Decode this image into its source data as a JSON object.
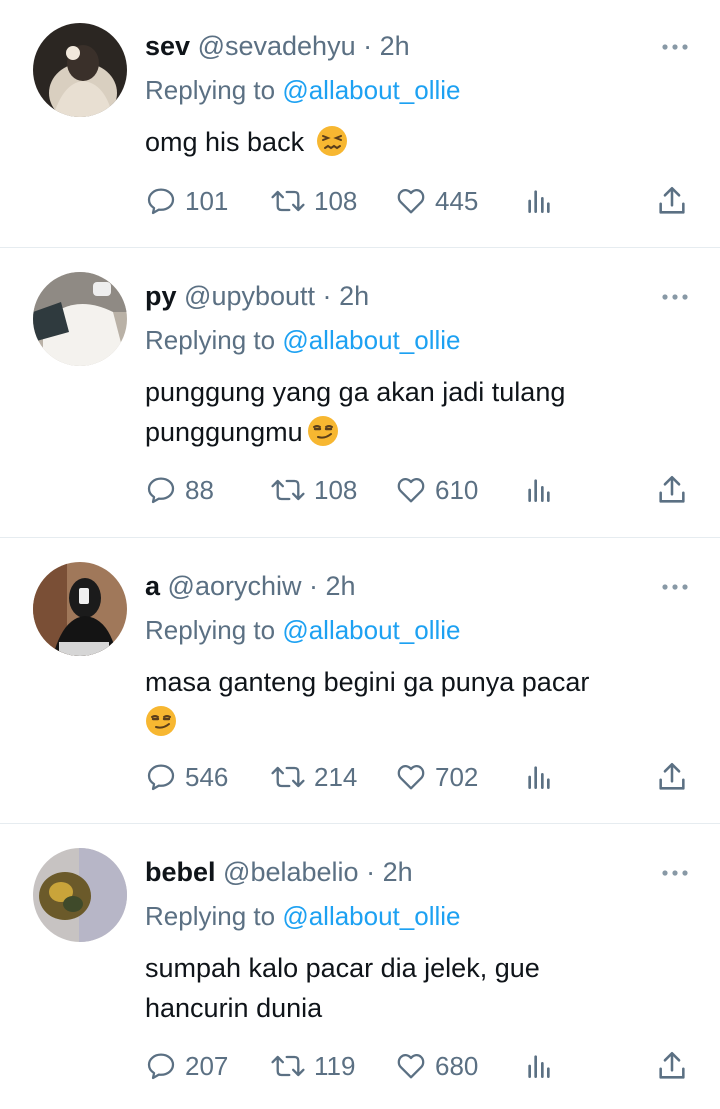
{
  "tweets": [
    {
      "name": "sev",
      "handle": "@sevadehyu",
      "dot": "·",
      "time": "2h",
      "replying_prefix": "Replying to",
      "replying_to": "@allabout_ollie",
      "text_lines": [
        "omg his back"
      ],
      "emoji": "confounded-face",
      "replies": "101",
      "retweets": "108",
      "likes": "445"
    },
    {
      "name": "py",
      "handle": "@upyboutt",
      "dot": "·",
      "time": "2h",
      "replying_prefix": "Replying to",
      "replying_to": "@allabout_ollie",
      "text_lines": [
        "punggung yang ga akan jadi tulang",
        "punggungmu"
      ],
      "emoji": "smirking-face",
      "replies": "88",
      "retweets": "108",
      "likes": "610"
    },
    {
      "name": "a",
      "handle": "@aorychiw",
      "dot": "·",
      "time": "2h",
      "replying_prefix": "Replying to",
      "replying_to": "@allabout_ollie",
      "text_lines": [
        "masa ganteng begini ga punya pacar",
        ""
      ],
      "emoji": "smirking-face",
      "replies": "546",
      "retweets": "214",
      "likes": "702"
    },
    {
      "name": "bebel",
      "handle": "@belabelio",
      "dot": "·",
      "time": "2h",
      "replying_prefix": "Replying to",
      "replying_to": "@allabout_ollie",
      "text_lines": [
        "sumpah kalo pacar dia jelek, gue",
        "hancurin dunia"
      ],
      "replies": "207",
      "retweets": "119",
      "likes": "680"
    }
  ],
  "colors": {
    "text": "#0f1419",
    "muted": "#5b7083",
    "link": "#1da1f2",
    "divider": "#e6ecf0",
    "emoji": "#f7b731"
  },
  "icons": [
    "reply-icon",
    "retweet-icon",
    "like-icon",
    "analytics-icon",
    "share-icon",
    "more-icon"
  ]
}
